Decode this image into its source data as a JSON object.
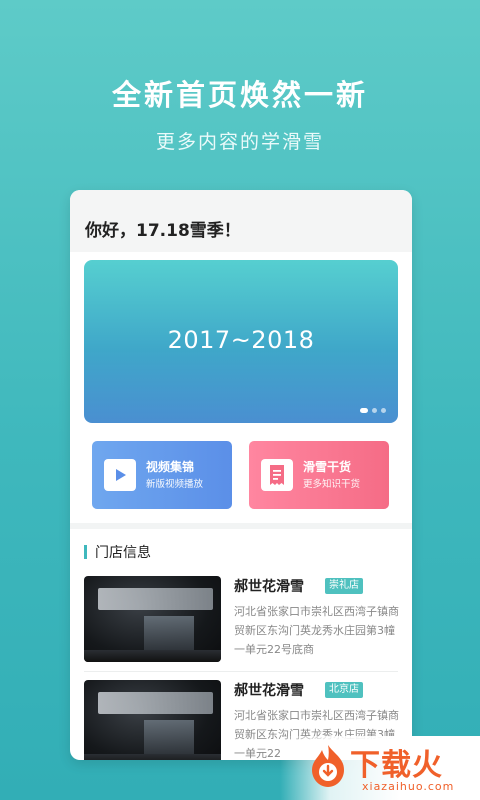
{
  "promo": {
    "headline": "全新首页焕然一新",
    "subline": "更多内容的学滑雪"
  },
  "app": {
    "greeting": "你好，17.18雪季！",
    "banner": {
      "text": "2017~2018",
      "slides": 3,
      "active_slide": 1
    },
    "tiles": [
      {
        "title": "视频集锦",
        "subtitle": "新版视频播放",
        "icon": "play-icon",
        "color": "#5b8fe8"
      },
      {
        "title": "滑雪干货",
        "subtitle": "更多知识干货",
        "icon": "receipt-icon",
        "color": "#f56c86"
      }
    ],
    "section_title": "门店信息",
    "stores": [
      {
        "name": "郝世花滑雪",
        "tag": "崇礼店",
        "address": "河北省张家口市崇礼区西湾子镇商贸新区东沟门英龙秀水庄园第3幢一单元22号底商"
      },
      {
        "name": "郝世花滑雪",
        "tag": "北京店",
        "address": "河北省张家口市崇礼区西湾子镇商贸新区东沟门英龙秀水庄园第3幢一单元22"
      }
    ]
  },
  "watermark": {
    "text": "下载火",
    "url": "xiazaihuo.com"
  },
  "colors": {
    "background": "#3fb8bd",
    "accent": "#4fc1bf",
    "watermark": "#f0602a"
  }
}
